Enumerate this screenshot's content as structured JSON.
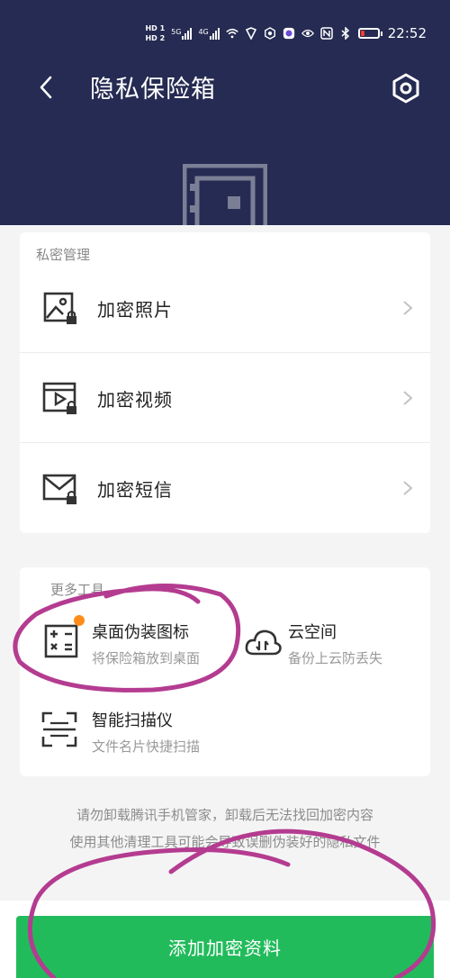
{
  "status_bar": {
    "hd1": "HD 1",
    "hd2": "HD 2",
    "net1": "5G",
    "net2": "4G",
    "time": "22:52"
  },
  "header": {
    "title": "隐私保险箱",
    "back_icon": "chevron-left-icon",
    "settings_icon": "hexagon-gear-icon",
    "background_color": "#252b52"
  },
  "private_management": {
    "section_label": "私密管理",
    "items": [
      {
        "label": "加密照片",
        "icon": "photo-lock-icon"
      },
      {
        "label": "加密视频",
        "icon": "video-lock-icon"
      },
      {
        "label": "加密短信",
        "icon": "message-lock-icon"
      }
    ]
  },
  "more_tools": {
    "section_label": "更多工具",
    "tools": [
      {
        "title": "桌面伪装图标",
        "subtitle": "将保险箱放到桌面",
        "icon": "calculator-icon",
        "badge_color": "#ff8c1a"
      },
      {
        "title": "云空间",
        "subtitle": "备份上云防丢失",
        "icon": "cloud-sync-icon"
      },
      {
        "title": "智能扫描仪",
        "subtitle": "文件名片快捷扫描",
        "icon": "scan-icon"
      }
    ]
  },
  "footer": {
    "line1": "请勿卸载腾讯手机管家，卸载后无法找回加密内容",
    "line2": "使用其他清理工具可能会导致误删伪装好的隐私文件"
  },
  "primary_action": {
    "label": "添加加密资料",
    "color": "#22bb5c"
  },
  "annotation_color": "#b43c90"
}
